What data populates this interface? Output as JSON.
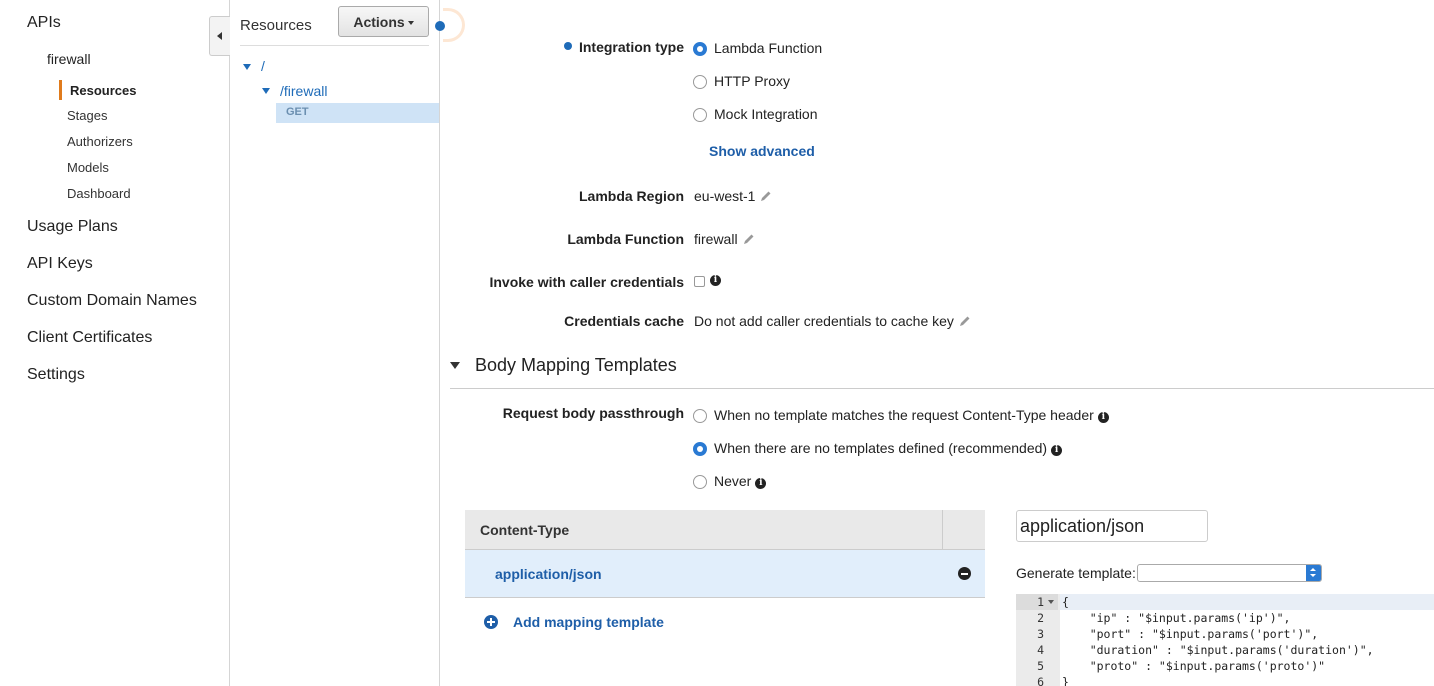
{
  "nav": {
    "apis": "APIs",
    "api_name": "firewall",
    "sub_items": [
      "Resources",
      "Stages",
      "Authorizers",
      "Models",
      "Dashboard"
    ],
    "top_items": [
      "Usage Plans",
      "API Keys",
      "Custom Domain Names",
      "Client Certificates",
      "Settings"
    ]
  },
  "tree": {
    "title": "Resources",
    "actions_label": "Actions",
    "root": "/",
    "child": "/firewall",
    "method": "GET"
  },
  "form": {
    "integration_type_label": "Integration type",
    "integration_options": [
      "Lambda Function",
      "HTTP Proxy",
      "Mock Integration"
    ],
    "integration_selected": "Lambda Function",
    "show_advanced": "Show advanced",
    "lambda_region_label": "Lambda Region",
    "lambda_region_value": "eu-west-1",
    "lambda_function_label": "Lambda Function",
    "lambda_function_value": "firewall",
    "invoke_label": "Invoke with caller credentials",
    "invoke_checked": false,
    "cache_label": "Credentials cache",
    "cache_value": "Do not add caller credentials to cache key"
  },
  "body_mapping": {
    "section_title": "Body Mapping Templates",
    "passthrough_label": "Request body passthrough",
    "passthrough_options": [
      "When no template matches the request Content-Type header",
      "When there are no templates defined (recommended)",
      "Never"
    ],
    "passthrough_selected": "When there are no templates defined (recommended)",
    "table_header": "Content-Type",
    "rows": [
      "application/json"
    ],
    "add_label": "Add mapping template",
    "content_type_input": "application/json",
    "generate_label": "Generate template:",
    "generate_value": ""
  },
  "editor": {
    "line_numbers": [
      "1",
      "2",
      "3",
      "4",
      "5",
      "6"
    ],
    "lines": [
      "{",
      "    \"ip\" : \"$input.params('ip')\",",
      "    \"port\" : \"$input.params('port')\",",
      "    \"duration\" : \"$input.params('duration')\",",
      "    \"proto\" : \"$input.params('proto')\"",
      "}"
    ]
  },
  "colors": {
    "link_blue": "#1e5ea8",
    "accent_orange": "#e07b1c",
    "selection_blue": "#e1eefb"
  }
}
